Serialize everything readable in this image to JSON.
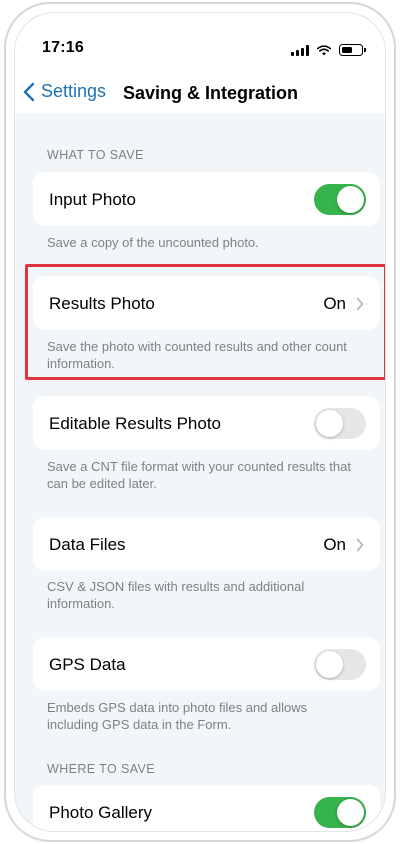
{
  "status_bar": {
    "time": "17:16"
  },
  "nav": {
    "back_label": "Settings",
    "title": "Saving & Integration"
  },
  "sections": {
    "what_to_save": "WHAT TO SAVE",
    "where_to_save": "WHERE TO SAVE"
  },
  "rows": {
    "input_photo": {
      "label": "Input Photo",
      "toggle": "on",
      "footnote": "Save a copy of the uncounted photo."
    },
    "results_photo": {
      "label": "Results Photo",
      "value": "On",
      "footnote": "Save the photo with counted results and other count information."
    },
    "editable_results_photo": {
      "label": "Editable Results Photo",
      "toggle": "off",
      "footnote": "Save a CNT file format with your counted results that can be edited later."
    },
    "data_files": {
      "label": "Data Files",
      "value": "On",
      "footnote": "CSV & JSON files with results and additional information."
    },
    "gps_data": {
      "label": "GPS Data",
      "toggle": "off",
      "footnote": "Embeds GPS data into photo files and allows including GPS data in the Form."
    },
    "photo_gallery": {
      "label": "Photo Gallery",
      "toggle": "on"
    }
  },
  "colors": {
    "accent": "#1f6fb8",
    "toggle_on": "#36b34a",
    "toggle_off": "#e5e6e8",
    "highlight": "#e0353a",
    "background": "#f2f6f9"
  }
}
